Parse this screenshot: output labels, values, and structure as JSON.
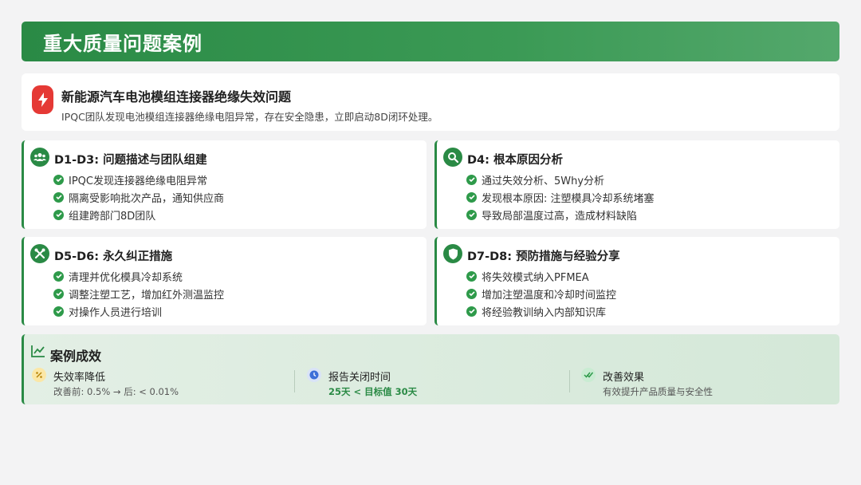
{
  "header": {
    "title": "重大质量问题案例"
  },
  "case": {
    "icon": "lightning-bolt-icon",
    "title": "新能源汽车电池模组连接器绝缘失效问题",
    "description": "IPQC团队发现电池模组连接器绝缘电阻异常，存在安全隐患，立即启动8D闭环处理。"
  },
  "steps": [
    {
      "icon": "team-icon",
      "title": "D1-D3: 问题描述与团队组建",
      "items": [
        "IPQC发现连接器绝缘电阻异常",
        "隔离受影响批次产品，通知供应商",
        "组建跨部门8D团队"
      ]
    },
    {
      "icon": "magnifier-icon",
      "title": "D4: 根本原因分析",
      "items": [
        "通过失效分析、5Why分析",
        "发现根本原因: 注塑模具冷却系统堵塞",
        "导致局部温度过高，造成材料缺陷"
      ]
    },
    {
      "icon": "tools-icon",
      "title": "D5-D6: 永久纠正措施",
      "items": [
        "清理并优化模具冷却系统",
        "调整注塑工艺，增加红外测温监控",
        "对操作人员进行培训"
      ]
    },
    {
      "icon": "shield-icon",
      "title": "D7-D8: 预防措施与经验分享",
      "items": [
        "将失效模式纳入PFMEA",
        "增加注塑温度和冷却时间监控",
        "将经验教训纳入内部知识库"
      ]
    }
  ],
  "results": {
    "title": "案例成效",
    "metrics": [
      {
        "icon": "percent-icon",
        "label": "失效率降低",
        "value": "改善前: 0.5% → 后: < 0.01%"
      },
      {
        "icon": "clock-icon",
        "label": "报告关闭时间",
        "value": "25天 < 目标值 30天"
      },
      {
        "icon": "double-check-icon",
        "label": "改善效果",
        "value": "有效提升产品质量与安全性"
      }
    ]
  },
  "colors": {
    "primary_green": "#2a8a45",
    "alert_red": "#e53935",
    "clock_blue": "#3d6fd8",
    "percent_yellow": "#f0c419"
  }
}
